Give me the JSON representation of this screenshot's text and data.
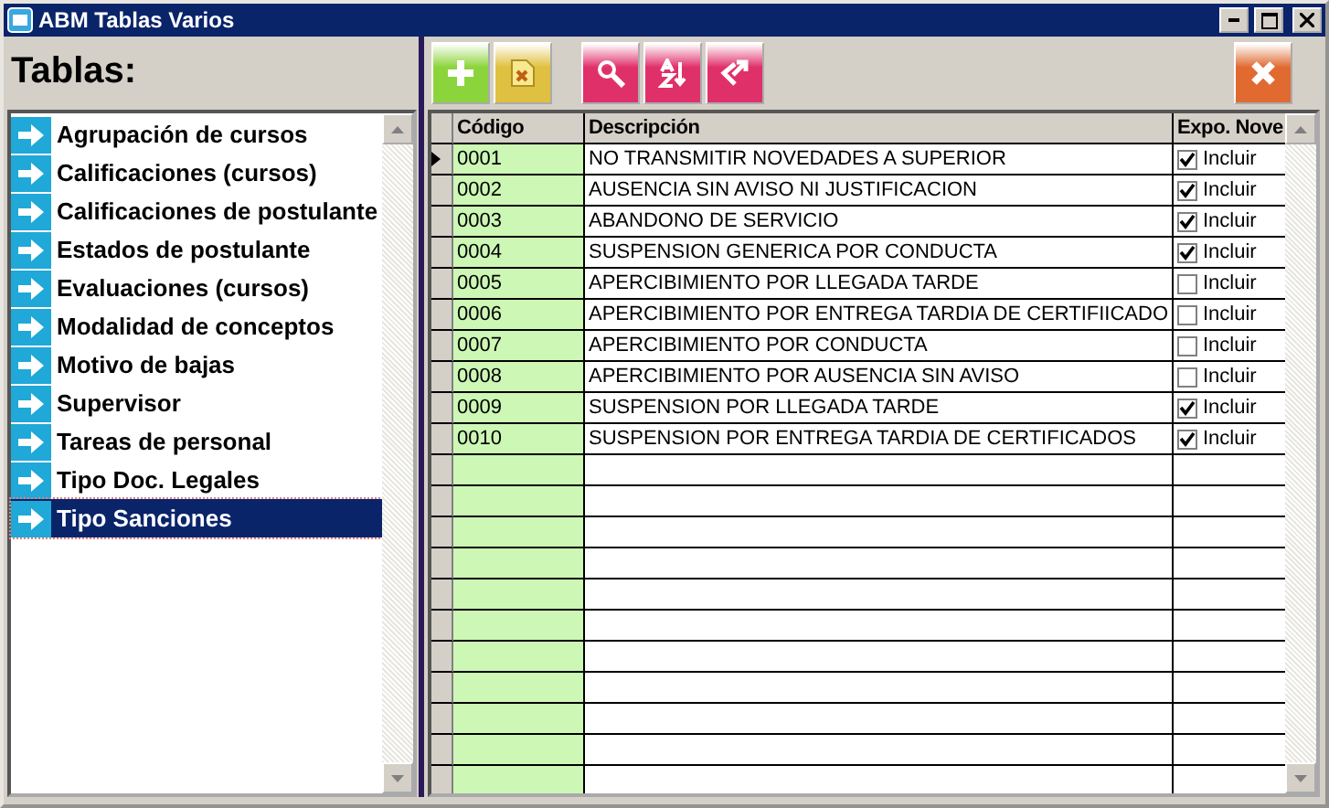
{
  "window": {
    "title": "ABM Tablas Varios"
  },
  "sidebar": {
    "title": "Tablas:",
    "items": [
      {
        "label": "Agrupación de cursos",
        "selected": false
      },
      {
        "label": "Calificaciones (cursos)",
        "selected": false
      },
      {
        "label": "Calificaciones de postulante",
        "selected": false
      },
      {
        "label": "Estados de postulante",
        "selected": false
      },
      {
        "label": "Evaluaciones (cursos)",
        "selected": false
      },
      {
        "label": "Modalidad de conceptos",
        "selected": false
      },
      {
        "label": "Motivo de bajas",
        "selected": false
      },
      {
        "label": "Supervisor",
        "selected": false
      },
      {
        "label": "Tareas de personal",
        "selected": false
      },
      {
        "label": "Tipo Doc. Legales",
        "selected": false
      },
      {
        "label": "Tipo Sanciones",
        "selected": true
      }
    ]
  },
  "toolbar": [
    {
      "kind": "add",
      "color": "#8cd43c"
    },
    {
      "kind": "delete",
      "color": "#e0c040"
    },
    {
      "kind": "search",
      "color": "#e0306a"
    },
    {
      "kind": "sort",
      "color": "#e0306a"
    },
    {
      "kind": "export",
      "color": "#e0306a"
    },
    {
      "kind": "close",
      "color": "#e06a30"
    }
  ],
  "table": {
    "columns": [
      "Código",
      "Descripción",
      "Expo. Nove"
    ],
    "rows": [
      {
        "code": "0001",
        "description": "NO TRANSMITIR NOVEDADES A SUPERIOR",
        "checked": true,
        "option": "Incluir",
        "selected": true
      },
      {
        "code": "0002",
        "description": "AUSENCIA SIN AVISO NI JUSTIFICACION",
        "checked": true,
        "option": "Incluir",
        "selected": false
      },
      {
        "code": "0003",
        "description": "ABANDONO DE SERVICIO",
        "checked": true,
        "option": "Incluir",
        "selected": false
      },
      {
        "code": "0004",
        "description": "SUSPENSION GENERICA POR CONDUCTA",
        "checked": true,
        "option": "Incluir",
        "selected": false
      },
      {
        "code": "0005",
        "description": "APERCIBIMIENTO POR LLEGADA TARDE",
        "checked": false,
        "option": "Incluir",
        "selected": false
      },
      {
        "code": "0006",
        "description": "APERCIBIMIENTO POR  ENTREGA TARDIA DE CERTIFIICADO",
        "checked": false,
        "option": "Incluir",
        "selected": false
      },
      {
        "code": "0007",
        "description": "APERCIBIMIENTO POR CONDUCTA",
        "checked": false,
        "option": "Incluir",
        "selected": false
      },
      {
        "code": "0008",
        "description": "APERCIBIMIENTO POR AUSENCIA SIN AVISO",
        "checked": false,
        "option": "Incluir",
        "selected": false
      },
      {
        "code": "0009",
        "description": "SUSPENSION POR LLEGADA TARDE",
        "checked": true,
        "option": "Incluir",
        "selected": false
      },
      {
        "code": "0010",
        "description": "SUSPENSION POR ENTREGA TARDIA DE CERTIFICADOS",
        "checked": true,
        "option": "Incluir",
        "selected": false
      }
    ]
  }
}
